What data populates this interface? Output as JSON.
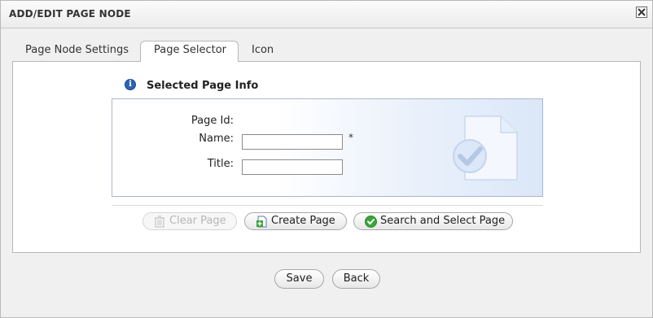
{
  "dialog": {
    "title": "ADD/EDIT PAGE NODE",
    "close_icon": "close-icon"
  },
  "tabs": [
    {
      "label": "Page Node Settings",
      "selected": false
    },
    {
      "label": "Page Selector",
      "selected": true
    },
    {
      "label": "Icon",
      "selected": false
    }
  ],
  "section": {
    "title": "Selected Page Info",
    "icon": "info-icon"
  },
  "form": {
    "page_id_label": "Page Id:",
    "page_id_value": "",
    "name_label": "Name:",
    "name_value": "",
    "required_marker": "*",
    "title_label": "Title:",
    "title_value": ""
  },
  "actions": {
    "clear_label": "Clear Page",
    "clear_enabled": false,
    "create_label": "Create Page",
    "search_label": "Search and Select Page"
  },
  "footer": {
    "save_label": "Save",
    "back_label": "Back"
  },
  "colors": {
    "accent": "#2f63b4",
    "success": "#3aa43a",
    "panel_gradient_end": "#dbe7f8"
  }
}
